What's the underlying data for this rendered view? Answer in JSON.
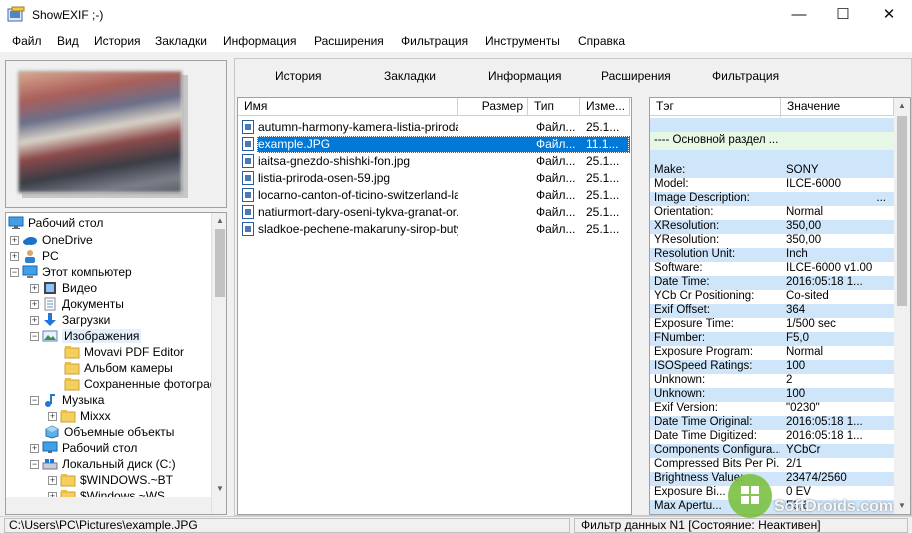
{
  "window": {
    "title": "ShowEXIF ;-)",
    "min": "—",
    "max": "☐",
    "close": "✕"
  },
  "menu": [
    "Файл",
    "Вид",
    "История",
    "Закладки",
    "Информация",
    "Расширения",
    "Фильтрация",
    "Инструменты",
    "Справка"
  ],
  "topnav": [
    "История",
    "Закладки",
    "Информация",
    "Расширения",
    "Фильтрация"
  ],
  "tree": [
    {
      "label": "Рабочий стол",
      "icon": "desktop-icon",
      "exp": ""
    },
    {
      "label": "OneDrive",
      "icon": "cloud-icon",
      "exp": "+"
    },
    {
      "label": "PC",
      "icon": "user-icon",
      "exp": "+"
    },
    {
      "label": "Этот компьютер",
      "icon": "computer-icon",
      "exp": "−"
    },
    {
      "label": "Видео",
      "icon": "video-folder-icon",
      "exp": "+"
    },
    {
      "label": "Документы",
      "icon": "documents-folder-icon",
      "exp": "+"
    },
    {
      "label": "Загрузки",
      "icon": "downloads-folder-icon",
      "exp": "+"
    },
    {
      "label": "Изображения",
      "icon": "pictures-folder-icon",
      "exp": "−"
    },
    {
      "label": "Movavi PDF Editor",
      "icon": "folder-icon",
      "exp": ""
    },
    {
      "label": "Альбом камеры",
      "icon": "folder-icon",
      "exp": ""
    },
    {
      "label": "Сохраненные фотографи",
      "icon": "folder-icon",
      "exp": ""
    },
    {
      "label": "Музыка",
      "icon": "music-folder-icon",
      "exp": "−"
    },
    {
      "label": "Mixxx",
      "icon": "folder-icon",
      "exp": "+"
    },
    {
      "label": "Объемные объекты",
      "icon": "3d-objects-icon",
      "exp": ""
    },
    {
      "label": "Рабочий стол",
      "icon": "desktop-icon",
      "exp": "+"
    },
    {
      "label": "Локальный диск (C:)",
      "icon": "drive-icon",
      "exp": "−"
    },
    {
      "label": "$WINDOWS.~BT",
      "icon": "folder-icon",
      "exp": "+"
    },
    {
      "label": "$Windows.~WS",
      "icon": "folder-icon",
      "exp": "+"
    }
  ],
  "files": {
    "headers": [
      "Имя",
      "Размер",
      "Тип",
      "Изме..."
    ],
    "rows": [
      {
        "name": "autumn-harmony-kamera-listia-priroda...",
        "type": "Файл...",
        "date": "25.1..."
      },
      {
        "name": "example.JPG",
        "type": "Файл...",
        "date": "11.1..."
      },
      {
        "name": "iaitsa-gnezdo-shishki-fon.jpg",
        "type": "Файл...",
        "date": "25.1..."
      },
      {
        "name": "listia-priroda-osen-59.jpg",
        "type": "Файл...",
        "date": "25.1..."
      },
      {
        "name": "locarno-canton-of-ticino-switzerland-la...",
        "type": "Файл...",
        "date": "25.1..."
      },
      {
        "name": "natiurmort-dary-oseni-tykva-granat-or...",
        "type": "Файл...",
        "date": "25.1..."
      },
      {
        "name": "sladkoe-pechene-makaruny-sirop-buty...",
        "type": "Файл...",
        "date": "25.1..."
      }
    ]
  },
  "exif": {
    "headers": [
      "Тэг",
      "Значение"
    ],
    "section": "---- Основной раздел ...",
    "rows": [
      {
        "tag": "Make:",
        "value": "SONY"
      },
      {
        "tag": "Model:",
        "value": "ILCE-6000"
      },
      {
        "tag": "Image Description:",
        "value": "..."
      },
      {
        "tag": "Orientation:",
        "value": "Normal"
      },
      {
        "tag": "XResolution:",
        "value": "350,00"
      },
      {
        "tag": "YResolution:",
        "value": "350,00"
      },
      {
        "tag": "Resolution Unit:",
        "value": "Inch"
      },
      {
        "tag": "Software:",
        "value": "ILCE-6000 v1.00"
      },
      {
        "tag": "Date Time:",
        "value": "2016:05:18 1..."
      },
      {
        "tag": "YCb Cr Positioning:",
        "value": "Co-sited"
      },
      {
        "tag": "Exif Offset:",
        "value": "364"
      },
      {
        "tag": "Exposure Time:",
        "value": "1/500 sec"
      },
      {
        "tag": "FNumber:",
        "value": "F5,0"
      },
      {
        "tag": "Exposure Program:",
        "value": "Normal"
      },
      {
        "tag": "ISOSpeed Ratings:",
        "value": "100"
      },
      {
        "tag": "Unknown:",
        "value": "2"
      },
      {
        "tag": "Unknown:",
        "value": "100"
      },
      {
        "tag": "Exif Version:",
        "value": "\"0230\""
      },
      {
        "tag": "Date Time Original:",
        "value": "2016:05:18 1..."
      },
      {
        "tag": "Date Time Digitized:",
        "value": "2016:05:18 1..."
      },
      {
        "tag": "Components Configura...",
        "value": "YCbCr"
      },
      {
        "tag": "Compressed Bits Per Pi...",
        "value": "2/1"
      },
      {
        "tag": "Brightness Value:",
        "value": "23474/2560"
      },
      {
        "tag": "Exposure Bi...",
        "value": "0 EV"
      },
      {
        "tag": "Max Apertu...",
        "value": "F3,6"
      }
    ]
  },
  "status": {
    "path": "C:\\Users\\PC\\Pictures\\example.JPG",
    "filter": "Фильтр данных N1 [Состояние: Неактивен]"
  },
  "watermark": "SoftDroids.com"
}
